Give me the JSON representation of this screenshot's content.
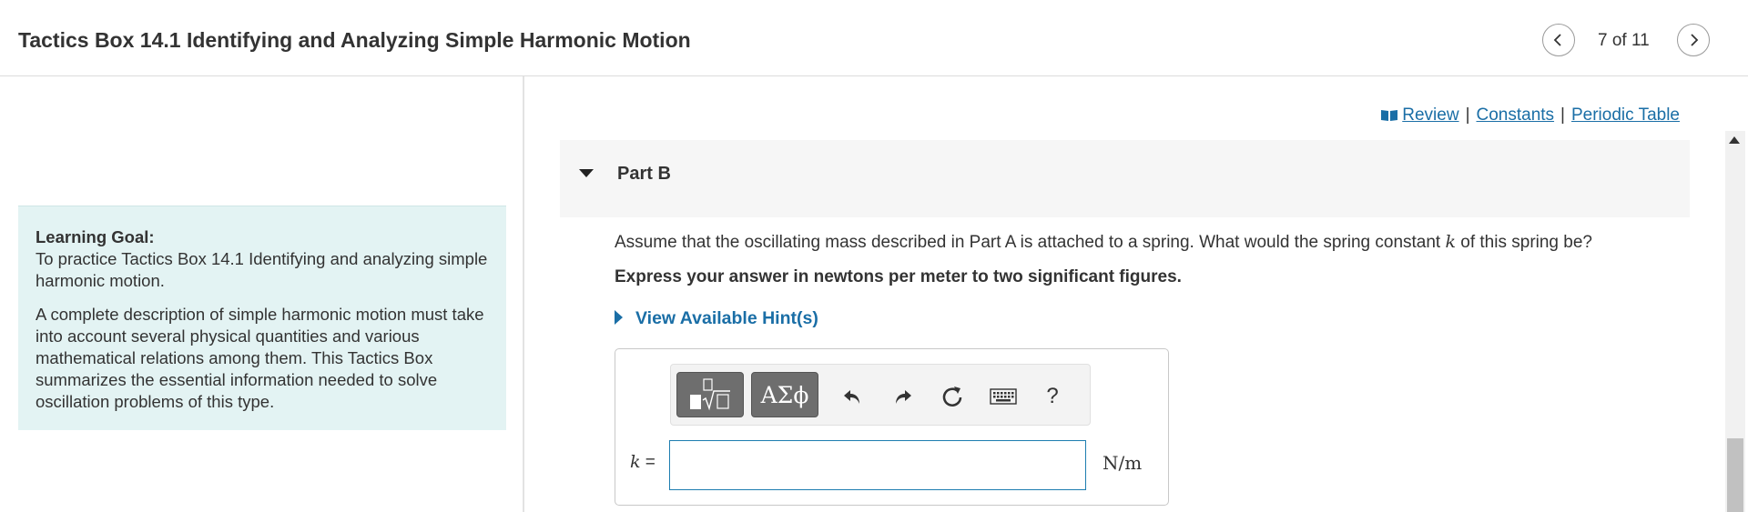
{
  "header": {
    "title": "Tactics Box 14.1 Identifying and Analyzing Simple Harmonic Motion",
    "page_counter": "7 of 11",
    "prev_icon": "chevron-left-icon",
    "next_icon": "chevron-right-icon"
  },
  "learning_goal": {
    "label": "Learning Goal:",
    "text": "To practice Tactics Box 14.1 Identifying and analyzing simple harmonic motion.",
    "description": "A complete description of simple harmonic motion must take into account several physical quantities and various mathematical relations among them. This Tactics Box summarizes the essential information needed to solve oscillation problems of this type."
  },
  "links": {
    "review": "Review",
    "constants": "Constants",
    "periodic_table": "Periodic Table",
    "separator": "|"
  },
  "part": {
    "title": "Part B",
    "question_before": "Assume that the oscillating mass described in Part A is attached to a spring. What would the spring constant ",
    "question_var": "k",
    "question_after": " of this spring be?",
    "instruction": "Express your answer in newtons per meter to two significant figures.",
    "hint_label": "View Available Hint(s)"
  },
  "answer": {
    "variable": "k",
    "equals": "=",
    "value": "",
    "unit": "N/m",
    "toolbar": {
      "greek_label": "ΑΣϕ",
      "help_label": "?",
      "icons": [
        "templates-icon",
        "greek-letters-icon",
        "undo-icon",
        "redo-icon",
        "reset-icon",
        "keyboard-icon",
        "help-icon"
      ]
    }
  },
  "colors": {
    "accent_link": "#1a6ea6",
    "goal_background": "#e3f3f3",
    "input_border": "#1d7db0"
  }
}
